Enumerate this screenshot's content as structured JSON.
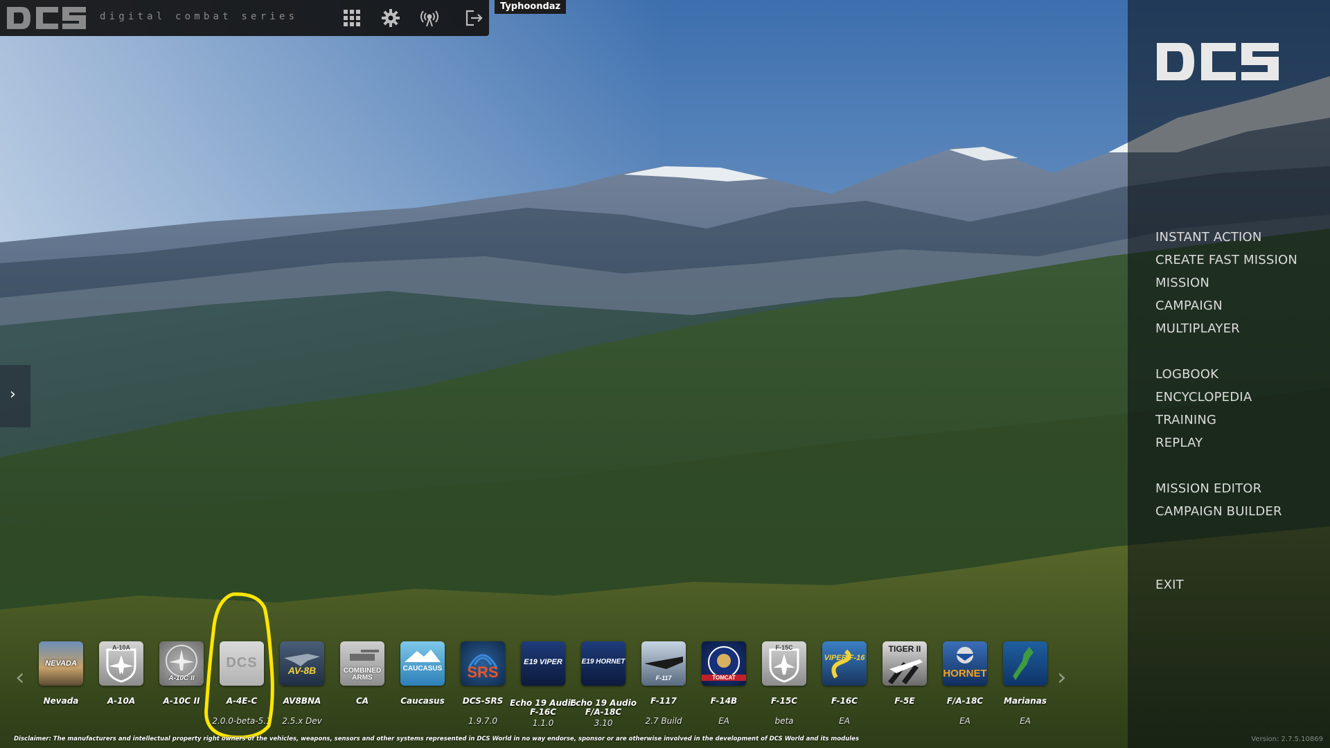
{
  "topbar": {
    "tagline": "digital combat series",
    "icons": [
      "modules-grid-icon",
      "settings-gear-icon",
      "signal-broadcast-icon",
      "logout-icon"
    ],
    "username": "Typhoondaz"
  },
  "menu": {
    "items": [
      "INSTANT ACTION",
      "CREATE FAST MISSION",
      "MISSION",
      "CAMPAIGN",
      "MULTIPLAYER",
      "LOGBOOK",
      "ENCYCLOPEDIA",
      "TRAINING",
      "REPLAY",
      "MISSION EDITOR",
      "CAMPAIGN BUILDER",
      "EXIT"
    ]
  },
  "modules": [
    {
      "label": "Nevada",
      "sub": "",
      "tile": "NEVADA"
    },
    {
      "label": "A-10A",
      "sub": "",
      "tile": "A-10A"
    },
    {
      "label": "A-10C II",
      "sub": "",
      "tile": "A-10C II"
    },
    {
      "label": "A-4E-C",
      "sub": "2.0.0-beta-5.1",
      "tile": "DCS"
    },
    {
      "label": "AV8BNA",
      "sub": "2.5.x Dev",
      "tile": "AV-8B"
    },
    {
      "label": "CA",
      "sub": "",
      "tile": "COMBINED ARMS"
    },
    {
      "label": "Caucasus",
      "sub": "",
      "tile": "CAUCASUS"
    },
    {
      "label": "DCS-SRS",
      "sub": "1.9.7.0",
      "tile": "SRS"
    },
    {
      "label": "Echo 19 Audio F-16C",
      "sub": "1.1.0",
      "tile": "E19 VIPER"
    },
    {
      "label": "Echo 19 Audio F/A-18C",
      "sub": "3.10",
      "tile": "E19 HORNET"
    },
    {
      "label": "F-117",
      "sub": "2.7 Build",
      "tile": "F-117"
    },
    {
      "label": "F-14B",
      "sub": "EA",
      "tile": "TOMCAT"
    },
    {
      "label": "F-15C",
      "sub": "beta",
      "tile": "F-15C"
    },
    {
      "label": "F-16C",
      "sub": "EA",
      "tile": "VIPER F-16"
    },
    {
      "label": "F-5E",
      "sub": "",
      "tile": "TIGER II"
    },
    {
      "label": "F/A-18C",
      "sub": "EA",
      "tile": "HORNET"
    },
    {
      "label": "Marianas",
      "sub": "EA",
      "tile": ""
    }
  ],
  "footer": {
    "disclaimer": "Disclaimer: The manufacturers and intellectual property right owners of the vehicles, weapons, sensors and other systems represented in DCS World in no way endorse, sponsor or are otherwise involved in the development of DCS World and its modules",
    "version": "Version: 2.7.5.10869"
  },
  "colors": {
    "highlight": "#ffe600",
    "menu_text": "#dcdcdc"
  }
}
